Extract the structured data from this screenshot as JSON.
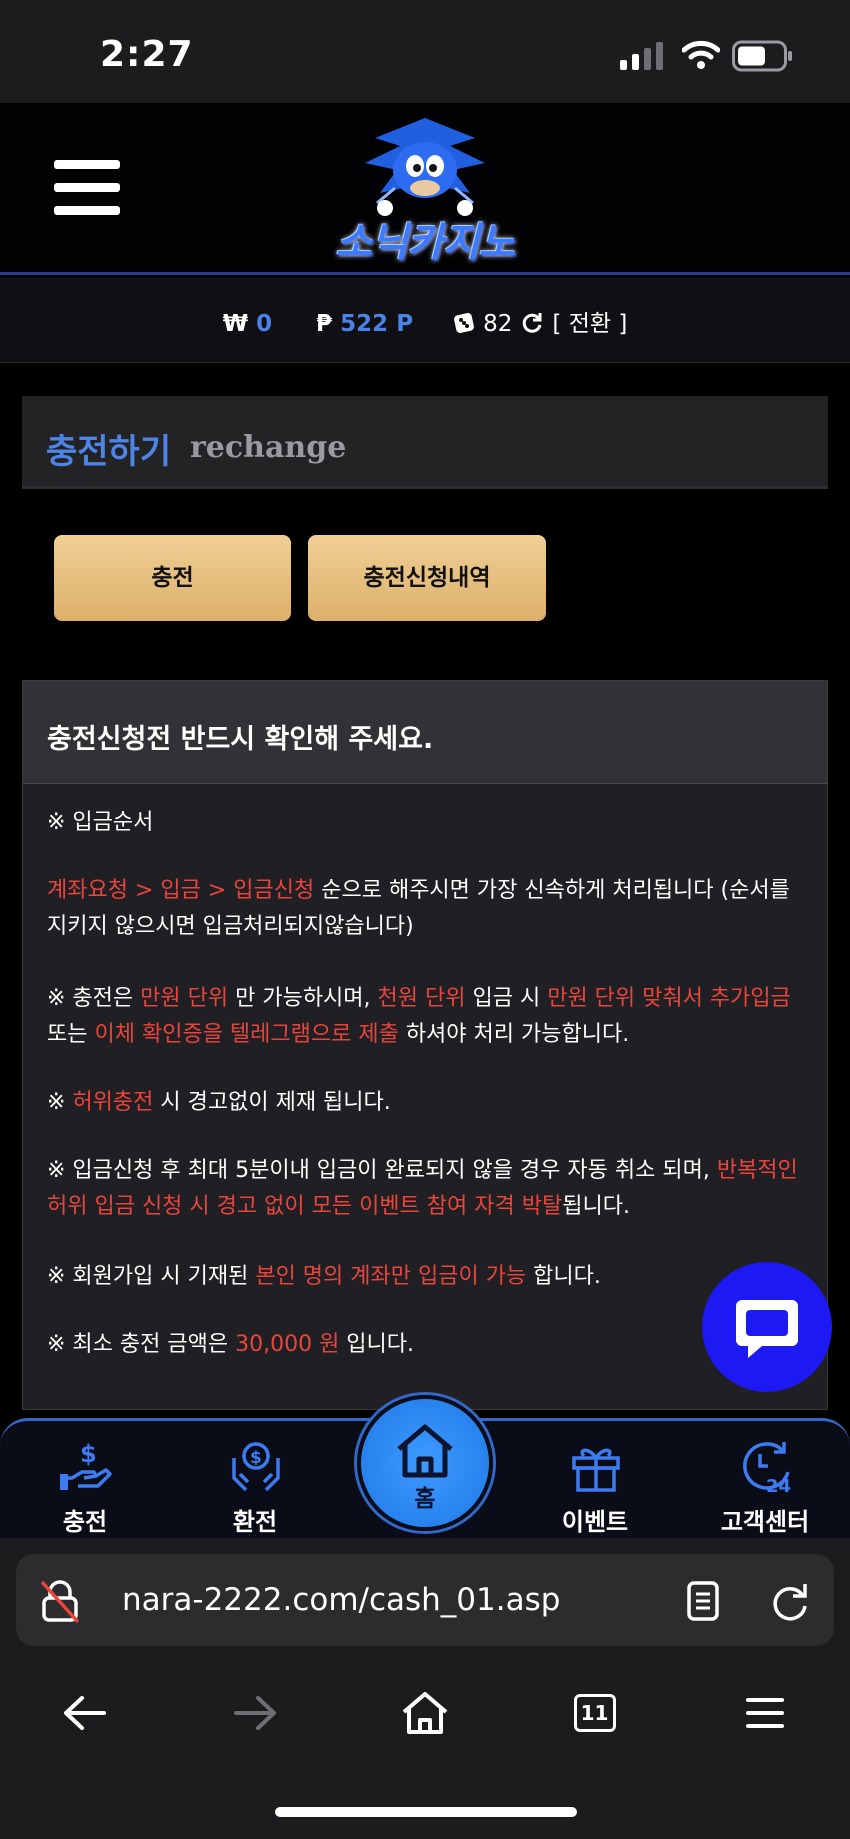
{
  "status_bar": {
    "time": "2:27"
  },
  "header": {
    "logo_text": "소닉카지노"
  },
  "balance": {
    "won_symbol": "₩",
    "won_value": "0",
    "point_symbol": "₱",
    "point_value": "522 P",
    "chip_value": "82",
    "convert_label": "[ 전환 ]"
  },
  "page_title": {
    "korean": "충전하기",
    "english": "rechange"
  },
  "tabs": {
    "charge": "충전",
    "charge_history": "충전신청내역"
  },
  "notice": {
    "heading": "충전신청전 반드시 확인해 주세요.",
    "order_title": "※ 입금순서",
    "p1": {
      "red": "계좌요청 > 입금 > 입금신청",
      "rest": " 순으로 해주시면 가장 신속하게 처리됩니다 (순서를 지키지 않으시면 입금처리되지않습니다)"
    },
    "p2": {
      "a": "※ 충전은 ",
      "b": "만원 단위",
      "c": " 만 가능하시며, ",
      "d": "천원 단위",
      "e": " 입금 시 ",
      "f": "만원 단위 맞춰서 추가입금",
      "g": " 또는 ",
      "h": "이체 확인증을 텔레그램으로 제출",
      "i": " 하셔야 처리 가능합니다."
    },
    "p3": {
      "a": "※ ",
      "b": "허위충전",
      "c": " 시 경고없이 제재 됩니다."
    },
    "p4": {
      "a": "※ 입금신청 후 최대 5분이내 입금이 완료되지 않을 경우 자동 취소 되며, ",
      "b": "반복적인 허위 입금 신청 시 경고 없이 모든 이벤트 참여 자격 박탈",
      "c": "됩니다."
    },
    "p5": {
      "a": "※ 회원가입 시 기재된 ",
      "b": "본인 명의 계좌만 입금이 가능",
      "c": " 합니다."
    },
    "p6": {
      "a": "※ 최소 충전 금액은 ",
      "b": "30,000 원",
      "c": " 입니다."
    }
  },
  "bottom_nav": {
    "charge": "충전",
    "exchange": "환전",
    "home": "홈",
    "event": "이벤트",
    "support": "고객센터"
  },
  "browser": {
    "url": "nara-2222.com/cash_01.asp",
    "tab_count": "11"
  },
  "colors": {
    "accent_blue": "#4b82e6",
    "gold": "#e8c283",
    "warning_red": "#e8453c",
    "chat_blue": "#1d19f2"
  }
}
